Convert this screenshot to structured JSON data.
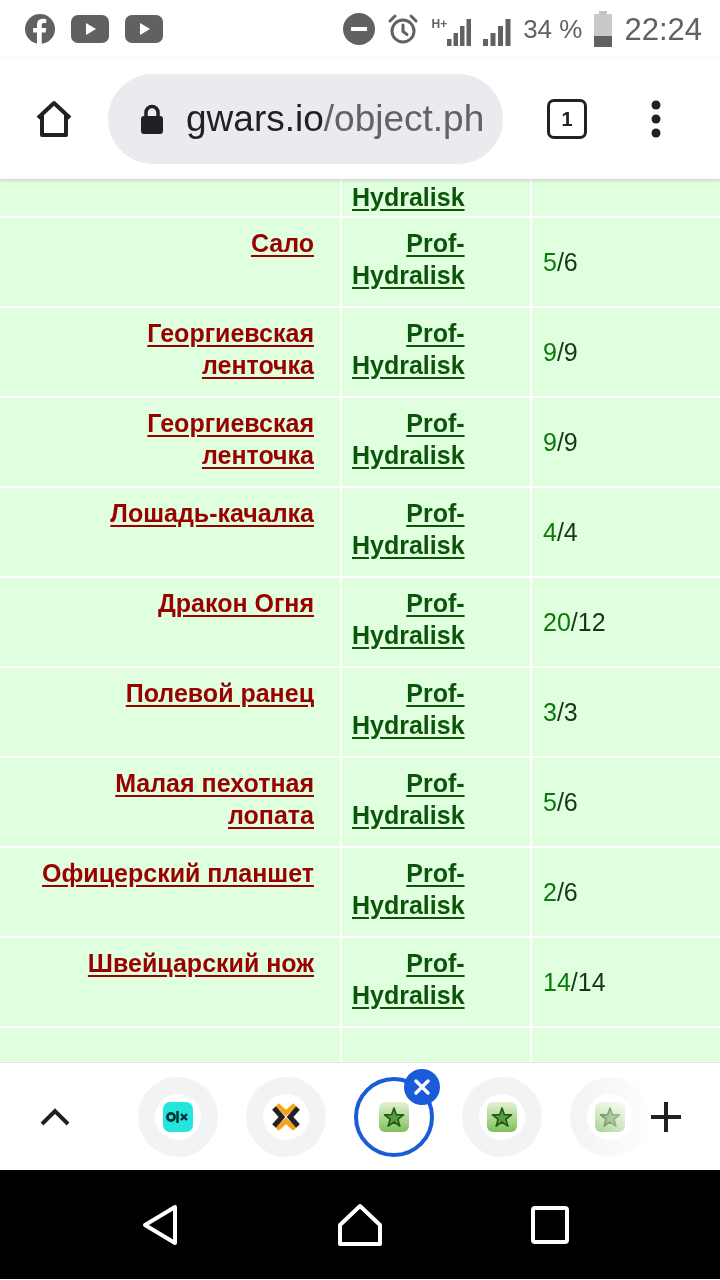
{
  "status_bar": {
    "network": "H+",
    "battery": "34 %",
    "time": "22:24"
  },
  "toolbar": {
    "url_host": "gwars.io",
    "url_path": "/object.ph",
    "tab_count": "1"
  },
  "table": {
    "rows": [
      {
        "owner": "Hydralisk"
      },
      {
        "item": "Сало",
        "owner": "Prof-Hydralisk",
        "durability_now": "5",
        "durability_of": "/6"
      },
      {
        "item": "Георгиевская ленточка",
        "owner": "Prof-Hydralisk",
        "durability_now": "9",
        "durability_of": "/9"
      },
      {
        "item": "Георгиевская ленточка",
        "owner": "Prof-Hydralisk",
        "durability_now": "9",
        "durability_of": "/9"
      },
      {
        "item": "Лошадь-качалка",
        "owner": "Prof-Hydralisk",
        "durability_now": "4",
        "durability_of": "/4"
      },
      {
        "item": "Дракон Огня",
        "owner": "Prof-Hydralisk",
        "durability_now": "20",
        "durability_of": "/12"
      },
      {
        "item": "Полевой ранец",
        "owner": "Prof-Hydralisk",
        "durability_now": "3",
        "durability_of": "/3"
      },
      {
        "item": "Малая пехотная лопата",
        "owner": "Prof-Hydralisk",
        "durability_now": "5",
        "durability_of": "/6"
      },
      {
        "item": "Офицерский планшет",
        "owner": "Prof-Hydralisk",
        "durability_now": "2",
        "durability_of": "/6"
      },
      {
        "item": "Швейцарский нож",
        "owner": "Prof-Hydralisk",
        "durability_now": "14",
        "durability_of": "/14"
      }
    ]
  },
  "tab_strip": {
    "tabs": [
      {
        "kind": "olx",
        "selected": false
      },
      {
        "kind": "cross",
        "selected": false
      },
      {
        "kind": "star",
        "selected": true
      },
      {
        "kind": "star",
        "selected": false
      },
      {
        "kind": "star",
        "selected": false
      }
    ]
  }
}
